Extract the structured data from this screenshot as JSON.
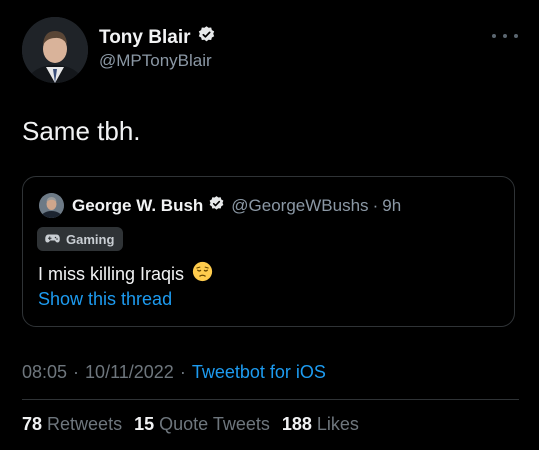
{
  "tweet": {
    "author": {
      "display_name": "Tony Blair",
      "handle": "@MPTonyBlair",
      "verified": true
    },
    "text": "Same tbh.",
    "more_icon": "more-horizontal-icon"
  },
  "quoted_tweet": {
    "author": {
      "display_name": "George W. Bush",
      "handle": "@GeorgeWBushs",
      "verified": true
    },
    "separator": "·",
    "time": "9h",
    "tag": {
      "icon": "game-controller-icon",
      "label": "Gaming"
    },
    "text": "I miss killing Iraqis",
    "emoji": "pensive-face-emoji",
    "show_thread_label": "Show this thread"
  },
  "meta": {
    "time": "08:05",
    "separator": "·",
    "date": "10/11/2022",
    "source": "Tweetbot for iOS"
  },
  "stats": {
    "retweets_count": "78",
    "retweets_label": "Retweets",
    "quotes_count": "15",
    "quotes_label": "Quote Tweets",
    "likes_count": "188",
    "likes_label": "Likes"
  },
  "colors": {
    "background": "#000000",
    "text_primary": "#e7e9ea",
    "text_secondary": "#8b98a5",
    "link": "#1d9bf0",
    "border": "#2f3336"
  }
}
